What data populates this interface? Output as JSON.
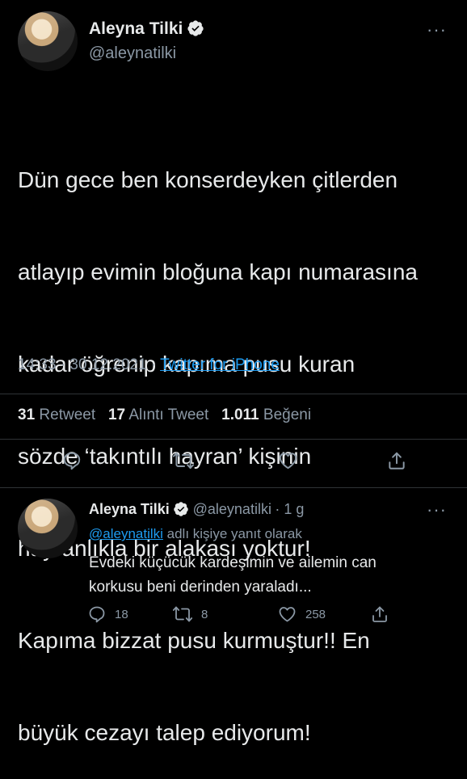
{
  "main_tweet": {
    "author_name": "Aleyna Tilki",
    "author_handle": "@aleynatilki",
    "more_label": "···",
    "text_lines": [
      "Dün gece ben konserdeyken çitlerden",
      "atlayıp evimin bloğuna kapı numarasına",
      "kadar öğrenip kapıma pusu kuran",
      "sözde ‘takıntılı hayran’ kişinin",
      "hayranlıkla bir alakası yoktur!",
      "Kapıma bizzat pusu kurmuştur!! En",
      "büyük cezayı talep ediyorum!"
    ],
    "time": "14:33 · 30.12.2021 · ",
    "source": "Twitter for iPhone",
    "stats": {
      "retweet_count": "31",
      "retweet_label": "Retweet",
      "quote_count": "17",
      "quote_label": "Alıntı Tweet",
      "like_count": "1.011",
      "like_label": "Beğeni"
    }
  },
  "reply_tweet": {
    "author_name": "Aleyna Tilki",
    "author_handle": "@aleynatilki",
    "age": "· 1 g",
    "more_label": "···",
    "reply_to_handle": "@aleynatilki",
    "reply_to_suffix": " adlı kişiye yanıt olarak",
    "text": "Evdeki küçücük kardeşimin ve ailemin can\nkorkusu beni derinden yaraladı...",
    "reply_count": "18",
    "retweet_count": "8",
    "like_count": "258"
  },
  "colors": {
    "background": "#000000",
    "text": "#e7e9ea",
    "secondary": "#8b98a5",
    "link": "#1d9bf0",
    "divider": "#2f3336"
  },
  "icons": [
    "verified-badge-icon",
    "reply-icon",
    "retweet-icon",
    "like-icon",
    "share-icon"
  ]
}
